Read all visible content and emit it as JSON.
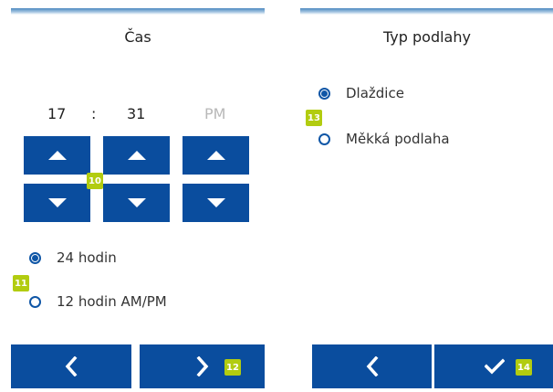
{
  "left_screen": {
    "title": "Čas",
    "time": {
      "hours": "17",
      "separator": ":",
      "minutes": "31",
      "ampm": "PM"
    },
    "format_options": [
      {
        "label": "24 hodin",
        "selected": true
      },
      {
        "label": "12 hodin AM/PM",
        "selected": false
      }
    ],
    "badges": {
      "arrows": "10",
      "format": "11",
      "next": "12"
    }
  },
  "right_screen": {
    "title": "Typ podlahy",
    "floor_options": [
      {
        "label": "Dlaždice",
        "selected": true
      },
      {
        "label": "Měkká podlaha",
        "selected": false
      }
    ],
    "badges": {
      "options": "13",
      "confirm": "14"
    }
  },
  "icons": {
    "up": "triangle-up-icon",
    "down": "triangle-down-icon",
    "back": "chevron-left-icon",
    "next": "chevron-right-icon",
    "confirm": "checkmark-icon"
  },
  "colors": {
    "button": "#0a4d9e",
    "radio": "#0f56a6",
    "badge": "#b2cc10",
    "header_gradient_top": "#4c88bf",
    "ampm_inactive": "#b8b8b8"
  }
}
